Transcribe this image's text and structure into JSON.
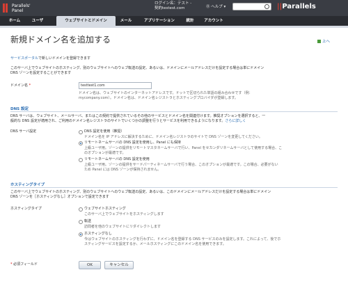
{
  "header": {
    "logo_line1": "Parallels'",
    "logo_line2": "Panel",
    "login_label": "ログイン名：テスト -",
    "login_value": "契約testest.com",
    "help": "ヘルプ",
    "brand": "Parallels"
  },
  "nav": {
    "tabs": [
      {
        "label": "ホーム"
      },
      {
        "label": "ユーザ"
      },
      {
        "label": "ウェブサイトとドメイン"
      },
      {
        "label": "メール"
      },
      {
        "label": "アプリケーション"
      },
      {
        "label": "統計"
      },
      {
        "label": "アカウント"
      }
    ]
  },
  "page": {
    "title": "新規ドメイン名を追加する",
    "up": "上へ",
    "portal_link": "サービスポータル",
    "portal_text": "で新しいドメインを登録できます",
    "intro1": "このサーバ上でウェブサイトのホスティング、別のウェブサイトへのウェブ転送の設定、あるいは、ドメインにメールアドレスだけを設定する場合は単にドメイン",
    "intro2": "DNS ゾーンを設定することができます"
  },
  "domain": {
    "label": "ドメイン名",
    "required": "*",
    "value": "testtest1.com",
    "hint1": "ドメイン名は、ウェブサイトのインターネットアドレスです。ドットで区切られた単語の組み合わせです（例：",
    "hint2": "mycompany.com）。ドメイン名は、ドメイン名レジストラとホスティングプロバイダが登録します。"
  },
  "dns": {
    "heading": "DNS 設定",
    "desc1": "DNS サーバは、ウェブサイト、メールサーバ、またはこの契約で提供されているその他のサービスとドメイン名を関連付けます。推奨オプションを選択すると、一",
    "desc2": "般的な DNS 設定が適用され、ご利用のドメイン名レジストラのサイトでいくつかの調整を行うとサービスを利用できるようになります。",
    "desc_link": "さらに詳しく",
    "label": "DNS サーバ設定",
    "options": [
      {
        "label": "DNS 設定を使用（推奨）",
        "desc1": "ドメイン名を IP アドレスに解決するために、ドメイン名レジストラのサイトで DNS ゾーンを変更してください。",
        "desc2": ""
      },
      {
        "label": "リモートネームサーバの DNS 設定を使用し、Panel にも保持",
        "desc1": "上級ユーザ用。ゾーンの提供をリモートマスタネームサーバで行い、Panel をセカンダリネームサーバとして使用する場合、こ",
        "desc2": "のオプションが最適です。"
      },
      {
        "label": "リモートネームサーバの DNS 設定を使用",
        "desc1": "上級ユーザ用。ゾーンの提供をサードパーティネームサーバで行う場合、このオプションが最適です。この場合、必要がない",
        "desc2": "ため Panel には DNS ゾーンが保持されません。"
      }
    ],
    "selected": 1
  },
  "hosting": {
    "heading": "ホスティングタイプ",
    "desc1": "このサーバ上でウェブサイトのホスティング、別のウェブサイトへのウェブ転送の設定、あるいは、このドメインにメールアドレスだけを設定する場合は単にドメイン",
    "desc2": "DNS ゾーンを［ホスティングなし］オプションで設定できます",
    "label": "ホスティングタイプ",
    "options": [
      {
        "label": "ウェブサイトホスティング",
        "desc1": "このサーバ上でウェブサイトをホスティングします",
        "desc2": ""
      },
      {
        "label": "転送",
        "desc1": "訪問者を他のウェブサイトにリダイレクトします",
        "desc2": ""
      },
      {
        "label": "ホスティングなし",
        "desc1": "今はウェブサイトのホスティングを行わずに、ドメイン名を登録する DNS サービスのみを設定します。これによって、後でホ",
        "desc2": "スティングサービスを設定するか、メールホスティングにこのドメイン名を使用できます。"
      }
    ],
    "selected": 2
  },
  "footer": {
    "required_note": "必須フィールド",
    "ok": "OK",
    "cancel": "キャンセル"
  }
}
